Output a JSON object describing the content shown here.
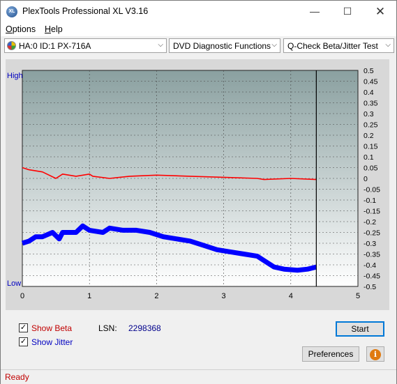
{
  "window": {
    "title": "PlexTools Professional XL V3.16",
    "icon_text": "XL"
  },
  "menu": {
    "options": "Options",
    "options_key": "O",
    "options_rest": "ptions",
    "help_key": "H",
    "help_rest": "elp"
  },
  "toolbar": {
    "drive": "HA:0 ID:1  PX-716A",
    "function": "DVD Diagnostic Functions",
    "test": "Q-Check Beta/Jitter Test"
  },
  "chart_data": {
    "type": "line",
    "left_axis_labels": {
      "high": "High",
      "low": "Low"
    },
    "xlim": [
      0,
      5
    ],
    "x_ticks": [
      "0",
      "1",
      "2",
      "3",
      "4",
      "5"
    ],
    "ylim": [
      -0.5,
      0.5
    ],
    "y_ticks": [
      "0.5",
      "0.45",
      "0.4",
      "0.35",
      "0.3",
      "0.25",
      "0.2",
      "0.15",
      "0.1",
      "0.05",
      "0",
      "-0.05",
      "-0.1",
      "-0.15",
      "-0.2",
      "-0.25",
      "-0.3",
      "-0.35",
      "-0.4",
      "-0.45",
      "-0.5"
    ],
    "end_marker_x": 4.38,
    "series": [
      {
        "color": "#ff0000",
        "kind": "beta",
        "points": [
          [
            0,
            0.05
          ],
          [
            0.1,
            0.04
          ],
          [
            0.3,
            0.03
          ],
          [
            0.5,
            0.0
          ],
          [
            0.6,
            0.02
          ],
          [
            0.8,
            0.01
          ],
          [
            1.0,
            0.02
          ],
          [
            1.05,
            0.01
          ],
          [
            1.3,
            0.0
          ],
          [
            1.6,
            0.01
          ],
          [
            2.0,
            0.015
          ],
          [
            2.5,
            0.01
          ],
          [
            3.0,
            0.005
          ],
          [
            3.5,
            0.0
          ],
          [
            3.6,
            -0.005
          ],
          [
            4.0,
            0.0
          ],
          [
            4.38,
            -0.005
          ]
        ]
      },
      {
        "color": "#0000ff",
        "kind": "jitter",
        "points": [
          [
            0,
            -0.3
          ],
          [
            0.1,
            -0.29
          ],
          [
            0.2,
            -0.27
          ],
          [
            0.3,
            -0.27
          ],
          [
            0.45,
            -0.25
          ],
          [
            0.55,
            -0.28
          ],
          [
            0.6,
            -0.25
          ],
          [
            0.8,
            -0.25
          ],
          [
            0.9,
            -0.22
          ],
          [
            1.0,
            -0.24
          ],
          [
            1.2,
            -0.25
          ],
          [
            1.3,
            -0.23
          ],
          [
            1.5,
            -0.24
          ],
          [
            1.7,
            -0.24
          ],
          [
            1.9,
            -0.25
          ],
          [
            2.1,
            -0.27
          ],
          [
            2.3,
            -0.28
          ],
          [
            2.5,
            -0.29
          ],
          [
            2.7,
            -0.31
          ],
          [
            2.9,
            -0.33
          ],
          [
            3.1,
            -0.34
          ],
          [
            3.3,
            -0.35
          ],
          [
            3.5,
            -0.36
          ],
          [
            3.6,
            -0.38
          ],
          [
            3.75,
            -0.41
          ],
          [
            3.9,
            -0.42
          ],
          [
            4.1,
            -0.425
          ],
          [
            4.25,
            -0.42
          ],
          [
            4.38,
            -0.41
          ]
        ]
      }
    ],
    "colors": {
      "plot_bg_top": "#8aa0a0",
      "plot_bg_bottom": "#ffffff",
      "grid": "#444444"
    }
  },
  "controls": {
    "show_beta": {
      "label": "Show Beta",
      "checked": true
    },
    "show_jitter": {
      "label": "Show Jitter",
      "checked": true
    },
    "lsn_label": "LSN:",
    "lsn_value": "2298368",
    "start_button": "Start",
    "preferences_button": "Preferences",
    "info_icon": "info-icon"
  },
  "status": {
    "text": "Ready"
  }
}
